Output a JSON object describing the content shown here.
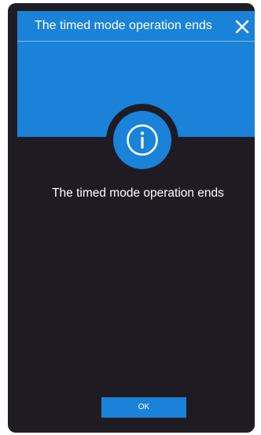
{
  "dialog": {
    "title": "The timed mode operation ends",
    "message": "The timed mode operation ends",
    "ok_label": "OK",
    "close_icon": "close-icon",
    "status_icon": "info-icon"
  },
  "colors": {
    "accent": "#1a82d8",
    "background": "#1e1c22",
    "text": "#ffffff"
  }
}
